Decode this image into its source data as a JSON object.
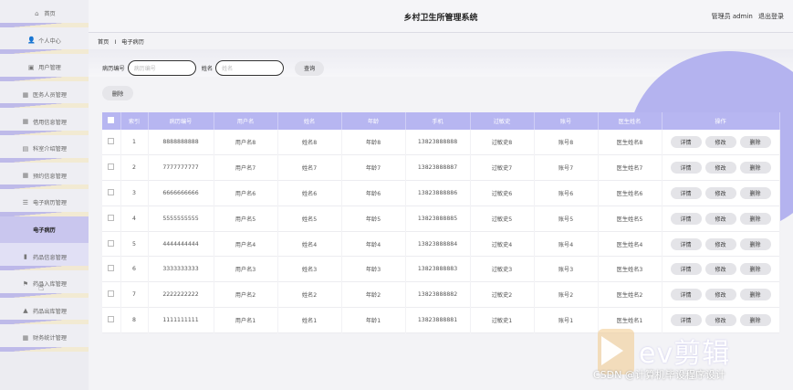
{
  "header": {
    "title": "乡村卫生所管理系统",
    "user": "管理员 admin",
    "logout": "退出登录"
  },
  "sidebar": {
    "items": [
      {
        "icon": "⌂",
        "label": "首页"
      },
      {
        "icon": "👤",
        "label": "个人中心"
      },
      {
        "icon": "▣",
        "label": "用户管理"
      },
      {
        "icon": "▦",
        "label": "医务人员管理"
      },
      {
        "icon": "▦",
        "label": "借用信息管理"
      },
      {
        "icon": "▤",
        "label": "科室介绍管理"
      },
      {
        "icon": "▦",
        "label": "预约信息管理"
      },
      {
        "icon": "☰",
        "label": "电子病历管理"
      },
      {
        "icon": "",
        "label": "电子病历"
      },
      {
        "icon": "▮",
        "label": "药品信息管理"
      },
      {
        "icon": "⚑",
        "label": "药品入库管理"
      },
      {
        "icon": "▲",
        "label": "药品出库管理"
      },
      {
        "icon": "▦",
        "label": "财务统计管理"
      }
    ]
  },
  "breadcrumb": {
    "home": "首页",
    "sep": "I",
    "current": "电子病历"
  },
  "search": {
    "field1_label": "病历编号",
    "field1_placeholder": "病历编号",
    "field2_label": "姓名",
    "field2_placeholder": "姓名",
    "search_button": "查询",
    "delete_button": "删除"
  },
  "table": {
    "headers": [
      "",
      "索引",
      "病历编号",
      "用户名",
      "姓名",
      "年龄",
      "手机",
      "过敏史",
      "账号",
      "医生姓名",
      "操作"
    ],
    "actions": {
      "detail": "详情",
      "edit": "修改",
      "delete": "删除"
    },
    "rows": [
      [
        "1",
        "8888888888",
        "用户名8",
        "姓名8",
        "年龄8",
        "13823888888",
        "过敏史8",
        "账号8",
        "医生姓名8"
      ],
      [
        "2",
        "7777777777",
        "用户名7",
        "姓名7",
        "年龄7",
        "13823888887",
        "过敏史7",
        "账号7",
        "医生姓名7"
      ],
      [
        "3",
        "6666666666",
        "用户名6",
        "姓名6",
        "年龄6",
        "13823888886",
        "过敏史6",
        "账号6",
        "医生姓名6"
      ],
      [
        "4",
        "5555555555",
        "用户名5",
        "姓名5",
        "年龄5",
        "13823888885",
        "过敏史5",
        "账号5",
        "医生姓名5"
      ],
      [
        "5",
        "4444444444",
        "用户名4",
        "姓名4",
        "年龄4",
        "13823888884",
        "过敏史4",
        "账号4",
        "医生姓名4"
      ],
      [
        "6",
        "3333333333",
        "用户名3",
        "姓名3",
        "年龄3",
        "13823888883",
        "过敏史3",
        "账号3",
        "医生姓名3"
      ],
      [
        "7",
        "2222222222",
        "用户名2",
        "姓名2",
        "年龄2",
        "13823888882",
        "过敏史2",
        "账号2",
        "医生姓名2"
      ],
      [
        "8",
        "1111111111",
        "用户名1",
        "姓名1",
        "年龄1",
        "13823888881",
        "过敏史1",
        "账号1",
        "医生姓名1"
      ]
    ]
  },
  "overlay": {
    "logo_text": "ev剪辑",
    "watermark": "CSDN @计算机毕设程序设计"
  }
}
